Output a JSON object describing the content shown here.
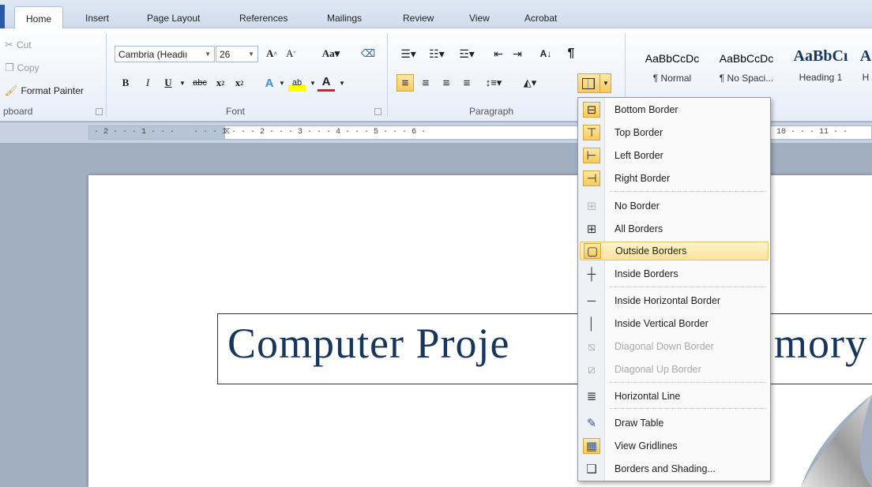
{
  "tabs": [
    {
      "label": "Home",
      "active": true
    },
    {
      "label": "Insert"
    },
    {
      "label": "Page Layout"
    },
    {
      "label": "References"
    },
    {
      "label": "Mailings"
    },
    {
      "label": "Review"
    },
    {
      "label": "View"
    },
    {
      "label": "Acrobat"
    }
  ],
  "clipboard": {
    "cut": "Cut",
    "copy": "Copy",
    "format_painter": "Format Painter",
    "group_label": "pboard"
  },
  "font": {
    "name": "Cambria (Headiı",
    "size": "26",
    "group_label": "Font"
  },
  "paragraph": {
    "group_label": "Paragraph"
  },
  "styles": [
    {
      "preview": "AaBbCcDc",
      "name": "¶ Normal"
    },
    {
      "preview": "AaBbCcDc",
      "name": "¶ No Spaci..."
    },
    {
      "preview": "AaBbCı",
      "name": "Heading 1"
    },
    {
      "preview": "A",
      "name": "H"
    }
  ],
  "ruler": {
    "left": "· 2 · · · 1 · · ·    · · · 1 · · · 2 · · · 3 · · · 4 · · · 5 · · · 6 ·",
    "right": "10 · · · 11 · ·"
  },
  "document": {
    "title_visible_left": "Computer Proje",
    "title_visible_right": "mory"
  },
  "border_menu": {
    "items": [
      {
        "label": "Bottom Border",
        "icon": "bottom-border-icon",
        "active": true
      },
      {
        "label": "Top Border",
        "icon": "top-border-icon",
        "active": true
      },
      {
        "label": "Left Border",
        "icon": "left-border-icon",
        "active": true
      },
      {
        "label": "Right Border",
        "icon": "right-border-icon",
        "active": true
      },
      {
        "label": "No Border",
        "icon": "no-border-icon"
      },
      {
        "label": "All Borders",
        "icon": "all-borders-icon"
      },
      {
        "label": "Outside Borders",
        "icon": "outside-borders-icon",
        "highlighted": true
      },
      {
        "label": "Inside Borders",
        "icon": "inside-borders-icon"
      },
      {
        "label": "Inside Horizontal Border",
        "icon": "inside-horizontal-border-icon"
      },
      {
        "label": "Inside Vertical Border",
        "icon": "inside-vertical-border-icon"
      },
      {
        "label": "Diagonal Down Border",
        "icon": "diagonal-down-border-icon",
        "disabled": true
      },
      {
        "label": "Diagonal Up Border",
        "icon": "diagonal-up-border-icon",
        "disabled": true
      },
      {
        "label": "Horizontal Line",
        "icon": "horizontal-line-icon"
      },
      {
        "label": "Draw Table",
        "icon": "draw-table-icon"
      },
      {
        "label": "View Gridlines",
        "icon": "view-gridlines-icon",
        "active": true
      },
      {
        "label": "Borders and Shading...",
        "icon": "borders-shading-icon"
      }
    ]
  },
  "colors": {
    "accent": "#2a5aa8",
    "title_text": "#17365d",
    "highlight": "#fde29a"
  }
}
